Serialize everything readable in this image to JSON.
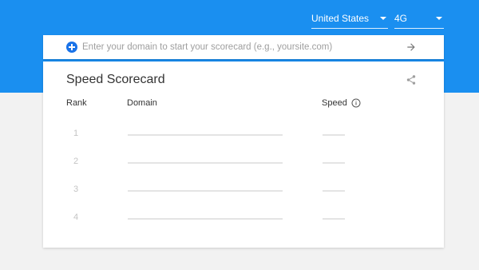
{
  "header": {
    "country": "United States",
    "network": "4G"
  },
  "search": {
    "placeholder": "Enter your domain to start your scorecard (e.g., yoursite.com)",
    "value": ""
  },
  "scorecard": {
    "title": "Speed Scorecard",
    "columns": {
      "rank": "Rank",
      "domain": "Domain",
      "speed": "Speed"
    },
    "rows": [
      {
        "rank": "1"
      },
      {
        "rank": "2"
      },
      {
        "rank": "3"
      },
      {
        "rank": "4"
      }
    ]
  },
  "colors": {
    "hero": "#1a8ff0",
    "accent": "#1a73e8",
    "background": "#f2f2f2",
    "placeholder_line": "#e4e4e4"
  },
  "icons": {
    "add": "plus-circle-icon",
    "submit": "arrow-right-icon",
    "share": "share-icon",
    "info": "info-icon",
    "dropdown": "caret-down-icon"
  }
}
